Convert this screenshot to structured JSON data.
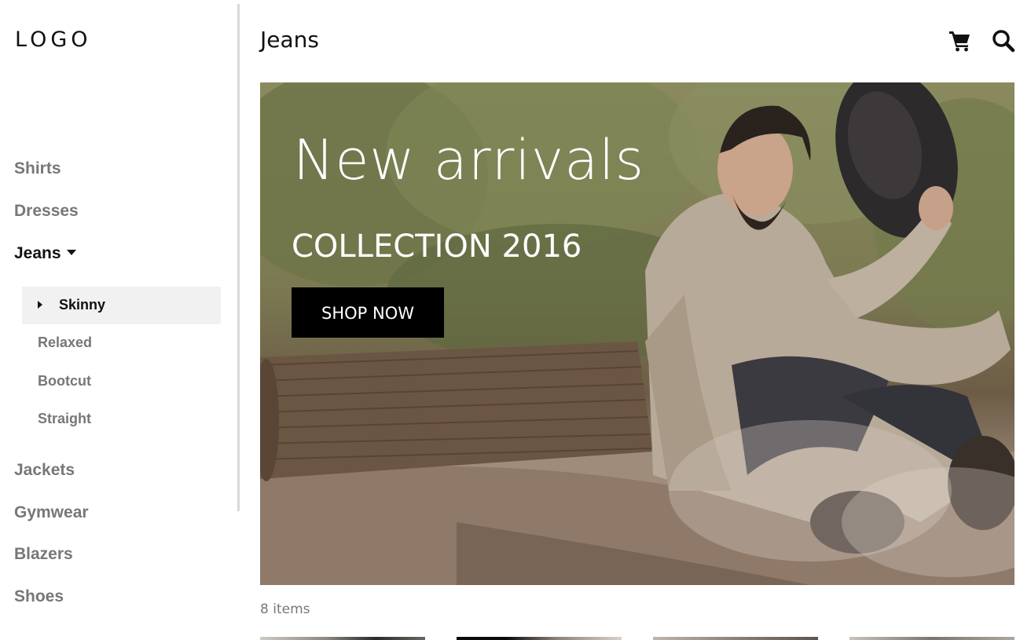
{
  "logo": "LOGO",
  "sidebar": {
    "items": [
      {
        "label": "Shirts"
      },
      {
        "label": "Dresses"
      },
      {
        "label": "Jeans",
        "active": true
      },
      {
        "label": "Jackets"
      },
      {
        "label": "Gymwear"
      },
      {
        "label": "Blazers"
      },
      {
        "label": "Shoes"
      }
    ],
    "sub_items": [
      {
        "label": "Skinny",
        "active": true
      },
      {
        "label": "Relaxed"
      },
      {
        "label": "Bootcut"
      },
      {
        "label": "Straight"
      }
    ]
  },
  "header": {
    "title": "Jeans",
    "cart_icon": "cart-icon",
    "search_icon": "search-icon"
  },
  "hero": {
    "heading": "New arrivals",
    "subheading": "COLLECTION 2016",
    "button_label": "SHOP NOW"
  },
  "products": {
    "count_label": "8 items"
  },
  "colors": {
    "active_text": "#111111",
    "muted_text": "#777777",
    "active_bg": "#f1f1f1",
    "button_bg": "#000000"
  }
}
